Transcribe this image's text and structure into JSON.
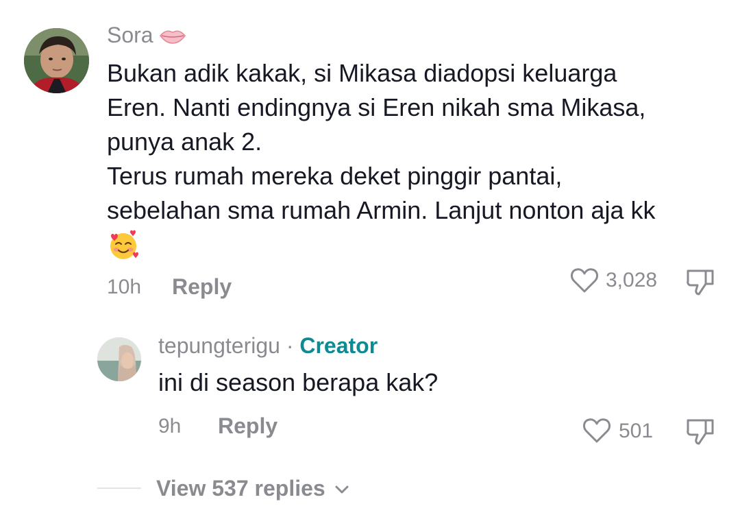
{
  "comment": {
    "username": "Sora",
    "username_icon": "lips-emoji-icon",
    "text_lines": [
      "Bukan adik kakak, si Mikasa diadopsi keluarga",
      "Eren. Nanti endingnya si Eren nikah sma Mikasa,",
      "punya anak 2.",
      "Terus rumah mereka deket pinggir pantai,",
      "sebelahan sma rumah Armin. Lanjut nonton aja kk"
    ],
    "trailing_emoji": "smiling-face-with-hearts-icon",
    "time": "10h",
    "reply_label": "Reply",
    "like_count": "3,028"
  },
  "reply": {
    "username": "tepungterigu",
    "separator": " · ",
    "badge": "Creator",
    "text": "ini di season berapa kak?",
    "time": "9h",
    "reply_label": "Reply",
    "like_count": "501"
  },
  "view_replies": {
    "label": "View 537 replies"
  },
  "colors": {
    "text": "#161823",
    "muted": "#8a8b91",
    "creator": "#0d8a92",
    "divider": "#e4e4e6"
  }
}
